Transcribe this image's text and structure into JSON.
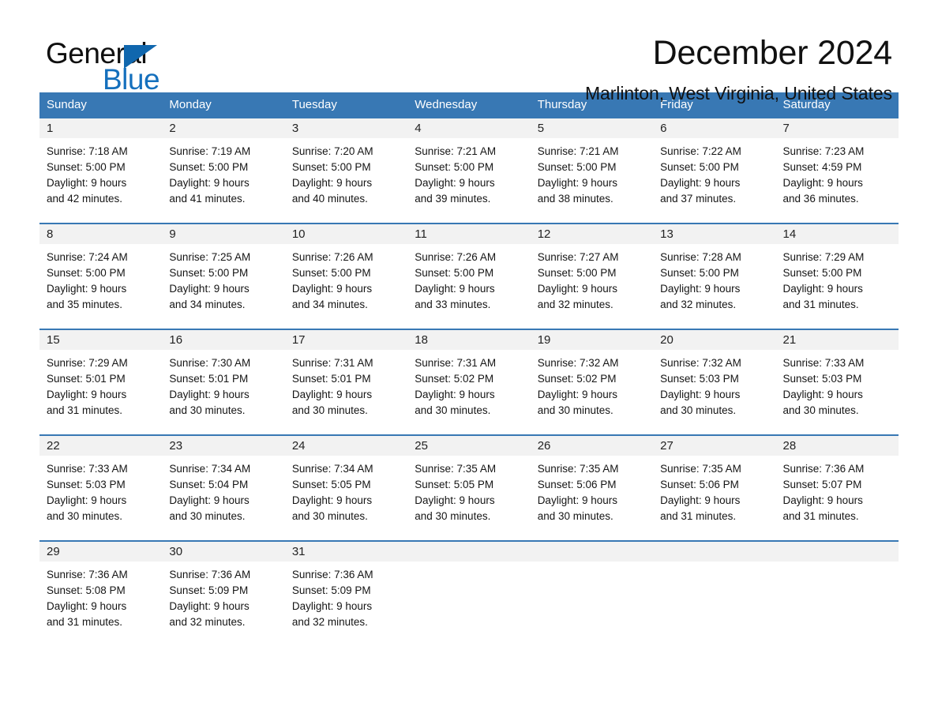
{
  "brand": {
    "name_part1": "General",
    "name_part2": "Blue",
    "triangle_color": "#1067ae",
    "blue_text_color": "#1570bd"
  },
  "header": {
    "month_title": "December 2024",
    "location": "Marlinton, West Virginia, United States",
    "header_bg_color": "#3878b4"
  },
  "calendar": {
    "weekdays": [
      "Sunday",
      "Monday",
      "Tuesday",
      "Wednesday",
      "Thursday",
      "Friday",
      "Saturday"
    ],
    "weeks": [
      [
        {
          "day": "1",
          "sunrise": "Sunrise: 7:18 AM",
          "sunset": "Sunset: 5:00 PM",
          "daylight_line1": "Daylight: 9 hours",
          "daylight_line2": "and 42 minutes."
        },
        {
          "day": "2",
          "sunrise": "Sunrise: 7:19 AM",
          "sunset": "Sunset: 5:00 PM",
          "daylight_line1": "Daylight: 9 hours",
          "daylight_line2": "and 41 minutes."
        },
        {
          "day": "3",
          "sunrise": "Sunrise: 7:20 AM",
          "sunset": "Sunset: 5:00 PM",
          "daylight_line1": "Daylight: 9 hours",
          "daylight_line2": "and 40 minutes."
        },
        {
          "day": "4",
          "sunrise": "Sunrise: 7:21 AM",
          "sunset": "Sunset: 5:00 PM",
          "daylight_line1": "Daylight: 9 hours",
          "daylight_line2": "and 39 minutes."
        },
        {
          "day": "5",
          "sunrise": "Sunrise: 7:21 AM",
          "sunset": "Sunset: 5:00 PM",
          "daylight_line1": "Daylight: 9 hours",
          "daylight_line2": "and 38 minutes."
        },
        {
          "day": "6",
          "sunrise": "Sunrise: 7:22 AM",
          "sunset": "Sunset: 5:00 PM",
          "daylight_line1": "Daylight: 9 hours",
          "daylight_line2": "and 37 minutes."
        },
        {
          "day": "7",
          "sunrise": "Sunrise: 7:23 AM",
          "sunset": "Sunset: 4:59 PM",
          "daylight_line1": "Daylight: 9 hours",
          "daylight_line2": "and 36 minutes."
        }
      ],
      [
        {
          "day": "8",
          "sunrise": "Sunrise: 7:24 AM",
          "sunset": "Sunset: 5:00 PM",
          "daylight_line1": "Daylight: 9 hours",
          "daylight_line2": "and 35 minutes."
        },
        {
          "day": "9",
          "sunrise": "Sunrise: 7:25 AM",
          "sunset": "Sunset: 5:00 PM",
          "daylight_line1": "Daylight: 9 hours",
          "daylight_line2": "and 34 minutes."
        },
        {
          "day": "10",
          "sunrise": "Sunrise: 7:26 AM",
          "sunset": "Sunset: 5:00 PM",
          "daylight_line1": "Daylight: 9 hours",
          "daylight_line2": "and 34 minutes."
        },
        {
          "day": "11",
          "sunrise": "Sunrise: 7:26 AM",
          "sunset": "Sunset: 5:00 PM",
          "daylight_line1": "Daylight: 9 hours",
          "daylight_line2": "and 33 minutes."
        },
        {
          "day": "12",
          "sunrise": "Sunrise: 7:27 AM",
          "sunset": "Sunset: 5:00 PM",
          "daylight_line1": "Daylight: 9 hours",
          "daylight_line2": "and 32 minutes."
        },
        {
          "day": "13",
          "sunrise": "Sunrise: 7:28 AM",
          "sunset": "Sunset: 5:00 PM",
          "daylight_line1": "Daylight: 9 hours",
          "daylight_line2": "and 32 minutes."
        },
        {
          "day": "14",
          "sunrise": "Sunrise: 7:29 AM",
          "sunset": "Sunset: 5:00 PM",
          "daylight_line1": "Daylight: 9 hours",
          "daylight_line2": "and 31 minutes."
        }
      ],
      [
        {
          "day": "15",
          "sunrise": "Sunrise: 7:29 AM",
          "sunset": "Sunset: 5:01 PM",
          "daylight_line1": "Daylight: 9 hours",
          "daylight_line2": "and 31 minutes."
        },
        {
          "day": "16",
          "sunrise": "Sunrise: 7:30 AM",
          "sunset": "Sunset: 5:01 PM",
          "daylight_line1": "Daylight: 9 hours",
          "daylight_line2": "and 30 minutes."
        },
        {
          "day": "17",
          "sunrise": "Sunrise: 7:31 AM",
          "sunset": "Sunset: 5:01 PM",
          "daylight_line1": "Daylight: 9 hours",
          "daylight_line2": "and 30 minutes."
        },
        {
          "day": "18",
          "sunrise": "Sunrise: 7:31 AM",
          "sunset": "Sunset: 5:02 PM",
          "daylight_line1": "Daylight: 9 hours",
          "daylight_line2": "and 30 minutes."
        },
        {
          "day": "19",
          "sunrise": "Sunrise: 7:32 AM",
          "sunset": "Sunset: 5:02 PM",
          "daylight_line1": "Daylight: 9 hours",
          "daylight_line2": "and 30 minutes."
        },
        {
          "day": "20",
          "sunrise": "Sunrise: 7:32 AM",
          "sunset": "Sunset: 5:03 PM",
          "daylight_line1": "Daylight: 9 hours",
          "daylight_line2": "and 30 minutes."
        },
        {
          "day": "21",
          "sunrise": "Sunrise: 7:33 AM",
          "sunset": "Sunset: 5:03 PM",
          "daylight_line1": "Daylight: 9 hours",
          "daylight_line2": "and 30 minutes."
        }
      ],
      [
        {
          "day": "22",
          "sunrise": "Sunrise: 7:33 AM",
          "sunset": "Sunset: 5:03 PM",
          "daylight_line1": "Daylight: 9 hours",
          "daylight_line2": "and 30 minutes."
        },
        {
          "day": "23",
          "sunrise": "Sunrise: 7:34 AM",
          "sunset": "Sunset: 5:04 PM",
          "daylight_line1": "Daylight: 9 hours",
          "daylight_line2": "and 30 minutes."
        },
        {
          "day": "24",
          "sunrise": "Sunrise: 7:34 AM",
          "sunset": "Sunset: 5:05 PM",
          "daylight_line1": "Daylight: 9 hours",
          "daylight_line2": "and 30 minutes."
        },
        {
          "day": "25",
          "sunrise": "Sunrise: 7:35 AM",
          "sunset": "Sunset: 5:05 PM",
          "daylight_line1": "Daylight: 9 hours",
          "daylight_line2": "and 30 minutes."
        },
        {
          "day": "26",
          "sunrise": "Sunrise: 7:35 AM",
          "sunset": "Sunset: 5:06 PM",
          "daylight_line1": "Daylight: 9 hours",
          "daylight_line2": "and 30 minutes."
        },
        {
          "day": "27",
          "sunrise": "Sunrise: 7:35 AM",
          "sunset": "Sunset: 5:06 PM",
          "daylight_line1": "Daylight: 9 hours",
          "daylight_line2": "and 31 minutes."
        },
        {
          "day": "28",
          "sunrise": "Sunrise: 7:36 AM",
          "sunset": "Sunset: 5:07 PM",
          "daylight_line1": "Daylight: 9 hours",
          "daylight_line2": "and 31 minutes."
        }
      ],
      [
        {
          "day": "29",
          "sunrise": "Sunrise: 7:36 AM",
          "sunset": "Sunset: 5:08 PM",
          "daylight_line1": "Daylight: 9 hours",
          "daylight_line2": "and 31 minutes."
        },
        {
          "day": "30",
          "sunrise": "Sunrise: 7:36 AM",
          "sunset": "Sunset: 5:09 PM",
          "daylight_line1": "Daylight: 9 hours",
          "daylight_line2": "and 32 minutes."
        },
        {
          "day": "31",
          "sunrise": "Sunrise: 7:36 AM",
          "sunset": "Sunset: 5:09 PM",
          "daylight_line1": "Daylight: 9 hours",
          "daylight_line2": "and 32 minutes."
        },
        {
          "day": "",
          "sunrise": "",
          "sunset": "",
          "daylight_line1": "",
          "daylight_line2": ""
        },
        {
          "day": "",
          "sunrise": "",
          "sunset": "",
          "daylight_line1": "",
          "daylight_line2": ""
        },
        {
          "day": "",
          "sunrise": "",
          "sunset": "",
          "daylight_line1": "",
          "daylight_line2": ""
        },
        {
          "day": "",
          "sunrise": "",
          "sunset": "",
          "daylight_line1": "",
          "daylight_line2": ""
        }
      ]
    ]
  }
}
